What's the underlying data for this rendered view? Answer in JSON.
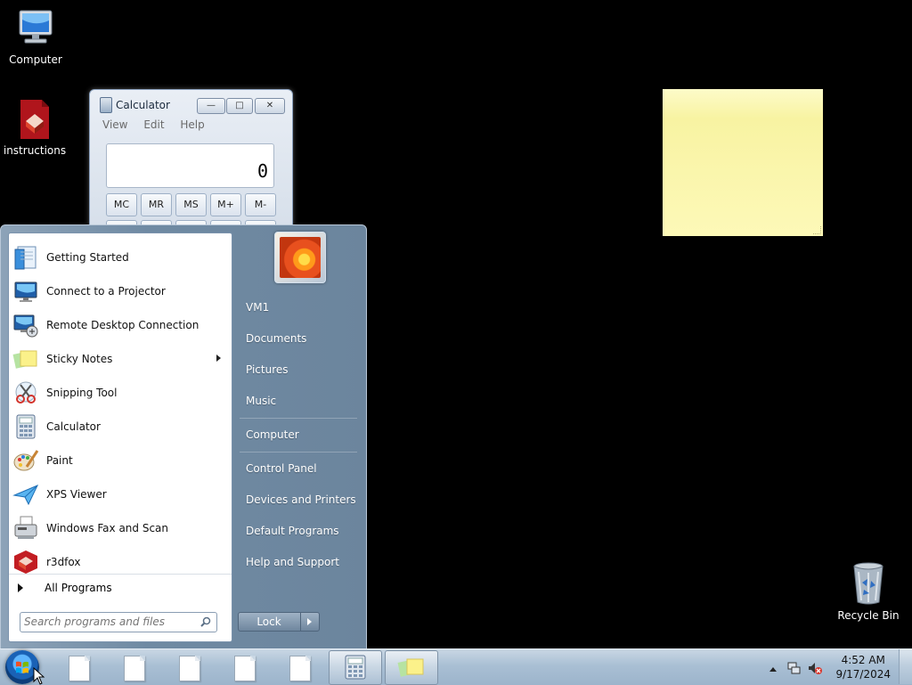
{
  "desktop": {
    "icons": [
      {
        "label": "Computer",
        "icon": "computer-icon"
      },
      {
        "label": "instructions",
        "icon": "r3dfox-file-icon"
      },
      {
        "label": "Recycle Bin",
        "icon": "recycle-bin-icon"
      }
    ]
  },
  "calculator": {
    "title": "Calculator",
    "menu": [
      "View",
      "Edit",
      "Help"
    ],
    "display": "0",
    "memory_buttons": [
      "MC",
      "MR",
      "MS",
      "M+",
      "M-"
    ]
  },
  "start_menu": {
    "programs": [
      {
        "label": "Getting Started",
        "icon": "getting-started-icon",
        "submenu": false
      },
      {
        "label": "Connect to a Projector",
        "icon": "projector-icon",
        "submenu": false
      },
      {
        "label": "Remote Desktop Connection",
        "icon": "remote-desktop-icon",
        "submenu": false
      },
      {
        "label": "Sticky Notes",
        "icon": "sticky-notes-icon",
        "submenu": true
      },
      {
        "label": "Snipping Tool",
        "icon": "snipping-tool-icon",
        "submenu": false
      },
      {
        "label": "Calculator",
        "icon": "calculator-icon",
        "submenu": false
      },
      {
        "label": "Paint",
        "icon": "paint-icon",
        "submenu": false
      },
      {
        "label": "XPS Viewer",
        "icon": "xps-viewer-icon",
        "submenu": false
      },
      {
        "label": "Windows Fax and Scan",
        "icon": "fax-scan-icon",
        "submenu": false
      },
      {
        "label": "r3dfox",
        "icon": "r3dfox-icon",
        "submenu": false
      }
    ],
    "all_programs": "All Programs",
    "search_placeholder": "Search programs and files",
    "right_links": [
      "VM1",
      "Documents",
      "Pictures",
      "Music",
      "Computer",
      "Control Panel",
      "Devices and Printers",
      "Default Programs",
      "Help and Support"
    ],
    "lock_label": "Lock"
  },
  "taskbar": {
    "time": "4:52 AM",
    "date": "9/17/2024"
  }
}
